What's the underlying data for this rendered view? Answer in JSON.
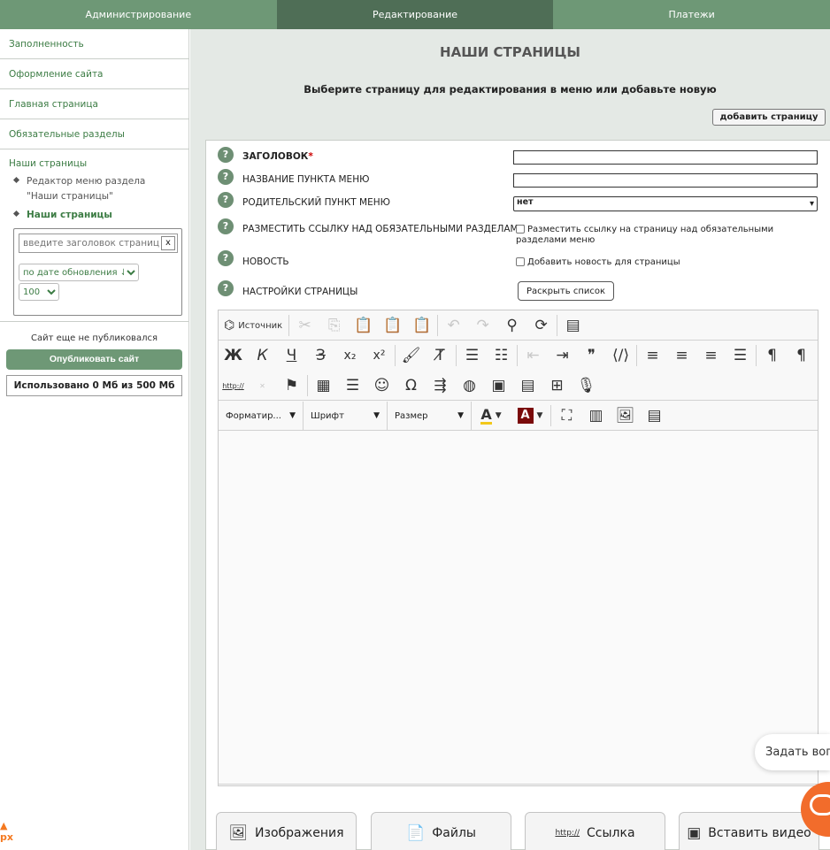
{
  "topnav": {
    "tabs": [
      "Администрирование",
      "Редактирование",
      "Платежи"
    ]
  },
  "sidebar": {
    "links": [
      "Заполненность",
      "Оформление сайта",
      "Главная страница",
      "Обязательные разделы"
    ],
    "section_head": "Наши страницы",
    "sub_items": [
      "Редактор меню раздела \"Наши страницы\"",
      "Наши страницы"
    ],
    "search_placeholder": "введите заголовок страницы",
    "clear_label": "x",
    "sort_value": "по дате обновления ↓",
    "count_value": "100",
    "not_published": "Сайт еще не публиковался",
    "publish_label": "Опубликовать сайт",
    "usage_label": "Использовано 0 Мб из 500 Мб",
    "logo_fragment": "рх"
  },
  "main": {
    "title": "НАШИ СТРАНИЦЫ",
    "subtitle": "Выберите страницу для редактирования в меню или добавьте новую",
    "add_page_label": "добавить страницу",
    "help_glyph": "?",
    "fields": {
      "heading_label": "ЗАГОЛОВОК",
      "required_mark": "*",
      "menu_name_label": "НАЗВАНИЕ ПУНКТА МЕНЮ",
      "parent_label": "РОДИТЕЛЬСКИЙ ПУНКТ МЕНЮ",
      "parent_value": "нет",
      "place_link_label": "РАЗМЕСТИТЬ ССЫЛКУ НАД ОБЯЗАТЕЛЬНЫМИ РАЗДЕЛАМИ",
      "place_link_checkbox": "Разместить ссылку на страницу над обязательными разделами меню",
      "news_label": "НОВОСТЬ",
      "news_checkbox": "Добавить новость для страницы",
      "settings_label": "НАСТРОЙКИ СТРАНИЦЫ",
      "expand_label": "Раскрыть список"
    },
    "editor": {
      "source_label": "Источник",
      "format_label": "Форматир...",
      "font_label": "Шрифт",
      "size_label": "Размер",
      "bold": "Ж",
      "italic": "К",
      "underline": "Ч",
      "strike": "З",
      "sub": "x₂",
      "sup": "x²",
      "text_color_letter": "A",
      "bg_color_letter": "A",
      "link_glyph": "http://"
    },
    "bottom_buttons": [
      "Изображения",
      "Файлы",
      "Ссылка",
      "Вставить видео"
    ]
  },
  "widget": {
    "ask_label": "Задать вопрос"
  },
  "colors": {
    "nav_bg": "#6e9876",
    "nav_active": "#4f6e56",
    "link_green": "#3c7c44",
    "main_bg": "#e4e9e5",
    "chat_orange": "#f26c2b"
  }
}
